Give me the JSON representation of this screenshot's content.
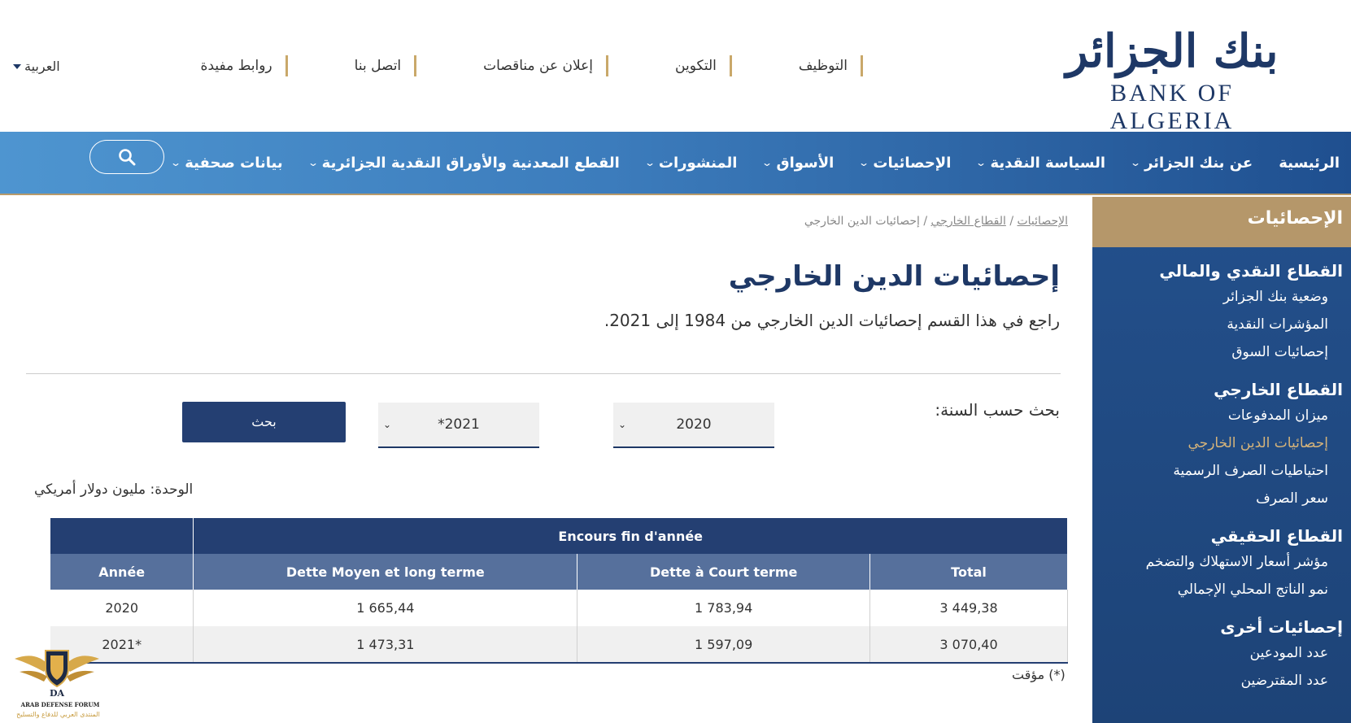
{
  "header": {
    "logo_arabic": "بنك الجزائر",
    "logo_latin": "BANK OF ALGERIA",
    "top_links": [
      "التوظيف",
      "التكوين",
      "إعلان عن مناقصات",
      "اتصل بنا",
      "روابط مفيدة"
    ],
    "language": "العربية"
  },
  "nav": {
    "items": [
      {
        "label": "الرئيسية",
        "has_dropdown": false
      },
      {
        "label": "عن بنك الجزائر",
        "has_dropdown": true
      },
      {
        "label": "السياسة النقدية",
        "has_dropdown": true
      },
      {
        "label": "الإحصائيات",
        "has_dropdown": true
      },
      {
        "label": "الأسواق",
        "has_dropdown": true
      },
      {
        "label": "المنشورات",
        "has_dropdown": true
      },
      {
        "label": "القطع المعدنية والأوراق النقدية الجزائرية",
        "has_dropdown": true
      },
      {
        "label": "بيانات صحفية",
        "has_dropdown": true
      }
    ],
    "search_icon": "search-icon"
  },
  "sidebar": {
    "title": "الإحصائيات",
    "sections": [
      {
        "title": "القطاع النقدي والمالي",
        "links": [
          "وضعية بنك الجزائر",
          "المؤشرات النقدية",
          "إحصائيات السوق"
        ]
      },
      {
        "title": "القطاع الخارجي",
        "links": [
          "ميزان المدفوعات",
          "إحصائيات الدين الخارجي",
          "احتياطيات الصرف الرسمية",
          "سعر الصرف"
        ]
      },
      {
        "title": "القطاع الحقيقي",
        "links": [
          "مؤشر أسعار الاستهلاك والتضخم",
          "نمو الناتج المحلي الإجمالي"
        ]
      },
      {
        "title": "إحصائيات أخرى",
        "links": [
          "عدد المودعين",
          "عدد المقترضين"
        ]
      }
    ],
    "active_link": "إحصائيات الدين الخارجي"
  },
  "breadcrumb": {
    "items": [
      "الإحصائيات",
      "القطاع الخارجي",
      "إحصائيات الدين الخارجي"
    ],
    "separator": "/"
  },
  "page": {
    "title": "إحصائيات الدين الخارجي",
    "description": "راجع في هذا القسم إحصائيات الدين الخارجي من 1984 إلى 2021."
  },
  "search": {
    "label": "بحث حسب السنة:",
    "from_year": "2020",
    "to_year": "*2021",
    "button": "بحث"
  },
  "unit_label": "الوحدة: مليون دولار أمريكي",
  "table": {
    "group_header": "Encours fin d'année",
    "columns": [
      "Année",
      "Dette Moyen et long terme",
      "Dette à Court terme",
      "Total"
    ],
    "rows": [
      [
        "2020",
        "1 665,44",
        "1 783,94",
        "3 449,38"
      ],
      [
        "2021*",
        "1 473,31",
        "1 597,09",
        "3 070,40"
      ]
    ]
  },
  "footnote": "(*) مؤقت",
  "watermark": {
    "text": "ARAB DEFENSE FORUM",
    "text_arabic": "المنتدى العربي للدفاع والتسليح",
    "initials": "DA"
  },
  "colors": {
    "brand_navy": "#1e3866",
    "accent_gold": "#b5976a",
    "nav_blue": "#3c7cbc",
    "table_header": "#243f72",
    "table_subheader": "#56709c"
  }
}
